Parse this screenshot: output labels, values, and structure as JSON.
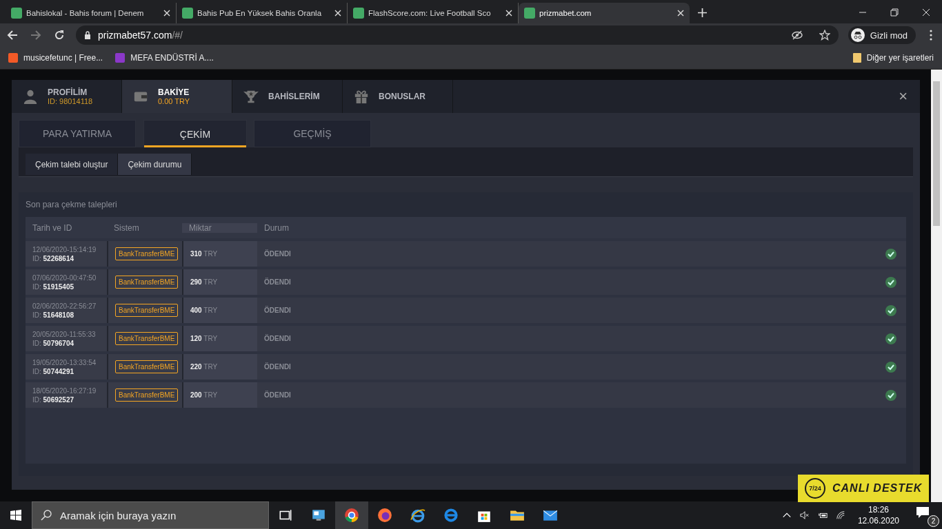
{
  "browser": {
    "tabs": [
      {
        "title": "Bahislokal - Bahis forum | Denem",
        "selected": false
      },
      {
        "title": "Bahis Pub En Yüksek Bahis Oranla",
        "selected": false
      },
      {
        "title": "FlashScore.com: Live Football Sco",
        "selected": false
      },
      {
        "title": "prizmabet.com",
        "selected": true
      }
    ],
    "address": {
      "domain": "prizmabet57.com",
      "path": "/#/"
    },
    "profile": "Gizli mod",
    "bookmarks": [
      "musicefetunc | Free...",
      "MEFA ENDÜSTRİ A...."
    ],
    "other_bookmarks": "Diğer yer işaretleri"
  },
  "account": {
    "top_tabs": [
      {
        "title": "PROFİLİM",
        "subtitle": "ID: 98014118",
        "selected": false
      },
      {
        "title": "BAKİYE",
        "subtitle": "0.00 TRY",
        "selected": true
      },
      {
        "title": "BAHİSLERİM",
        "selected": false
      },
      {
        "title": "BONUSLAR",
        "selected": false
      }
    ],
    "close": "×",
    "tabs": [
      {
        "label": "PARA YATIRMA",
        "selected": false
      },
      {
        "label": "ÇEKİM",
        "selected": true
      },
      {
        "label": "GEÇMİŞ",
        "selected": false
      }
    ],
    "sub_tabs": [
      {
        "label": "Çekim talebi oluştur",
        "selected": false
      },
      {
        "label": "Çekim durumu",
        "selected": true
      }
    ],
    "section_title": "Son para çekme talepleri",
    "table": {
      "columns": [
        "Tarih ve ID",
        "Sistem",
        "Miktar",
        "Durum"
      ],
      "rows": [
        {
          "date": "12/06/2020-15:14:19",
          "id": "ID: **52268614**",
          "system": "BankTransferBME",
          "amount": "**310** TRY",
          "status": "ÖDENDI",
          "paid": true
        },
        {
          "date": "07/06/2020-00:47:50",
          "id": "ID: **51915405**",
          "system": "BankTransferBME",
          "amount": "**290** TRY",
          "status": "ÖDENDI",
          "paid": true
        },
        {
          "date": "02/06/2020-22:56:27",
          "id": "ID: **51648108**",
          "system": "BankTransferBME",
          "amount": "**400** TRY",
          "status": "ÖDENDI",
          "paid": true
        },
        {
          "date": "20/05/2020-11:55:33",
          "id": "ID: **50796704**",
          "system": "BankTransferBME",
          "amount": "**120** TRY",
          "status": "ÖDENDI",
          "paid": true
        },
        {
          "date": "19/05/2020-13:33:54",
          "id": "ID: **50744291**",
          "system": "BankTransferBME",
          "amount": "**220** TRY",
          "status": "ÖDENDI",
          "paid": true
        },
        {
          "date": "18/05/2020-16:27:19",
          "id": "ID: **50692527**",
          "system": "BankTransferBME",
          "amount": "**200** TRY",
          "status": "ÖDENDI",
          "paid": true
        }
      ]
    }
  },
  "live_support": {
    "hours": "7/24",
    "label": "CANLI DESTEK"
  },
  "taskbar": {
    "search_placeholder": "Aramak için buraya yazın",
    "time": "18:26",
    "date": "12.06.2020",
    "notifications": "2"
  }
}
